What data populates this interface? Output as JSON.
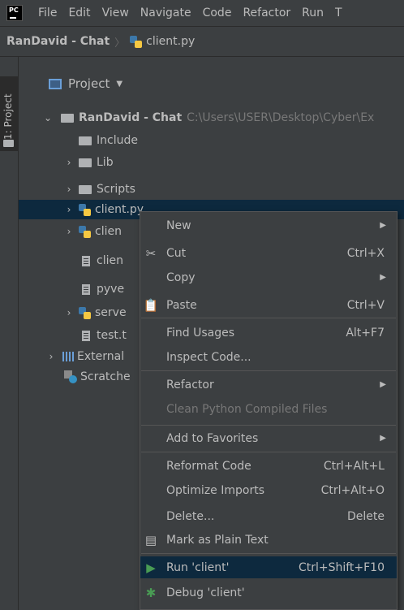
{
  "menubar": {
    "logo_text": "PC",
    "items": [
      "File",
      "Edit",
      "View",
      "Navigate",
      "Code",
      "Refactor",
      "Run",
      "T"
    ]
  },
  "breadcrumb": {
    "project": "RanDavid - Chat",
    "file": "client.py"
  },
  "side_tab": {
    "label": "1: Project"
  },
  "project_panel": {
    "title": "Project"
  },
  "tree": {
    "root_name": "RanDavid - Chat",
    "root_path": "C:\\Users\\USER\\Desktop\\Cyber\\Ex",
    "include": "Include",
    "lib": "Lib",
    "scripts": "Scripts",
    "client_py": "client.py",
    "client2": "clien",
    "client3": "clien",
    "pyve": "pyve",
    "server": "serve",
    "test": "test.t",
    "external": "External",
    "scratches": "Scratche"
  },
  "context_menu": {
    "new": "New",
    "cut": "Cut",
    "cut_shortcut": "Ctrl+X",
    "copy": "Copy",
    "paste": "Paste",
    "paste_shortcut": "Ctrl+V",
    "find_usages": "Find Usages",
    "find_usages_shortcut": "Alt+F7",
    "inspect_code": "Inspect Code...",
    "refactor": "Refactor",
    "clean_python": "Clean Python Compiled Files",
    "add_favorites": "Add to Favorites",
    "reformat": "Reformat Code",
    "reformat_shortcut": "Ctrl+Alt+L",
    "optimize_imports": "Optimize Imports",
    "optimize_shortcut": "Ctrl+Alt+O",
    "delete": "Delete...",
    "delete_shortcut": "Delete",
    "mark_plain": "Mark as Plain Text",
    "run": "Run 'client'",
    "run_shortcut": "Ctrl+Shift+F10",
    "debug": "Debug 'client'"
  },
  "colors": {
    "background": "#3c3f41",
    "selection": "#0d293e",
    "highlight": "#4b6eaf",
    "text": "#bbbbbb"
  }
}
